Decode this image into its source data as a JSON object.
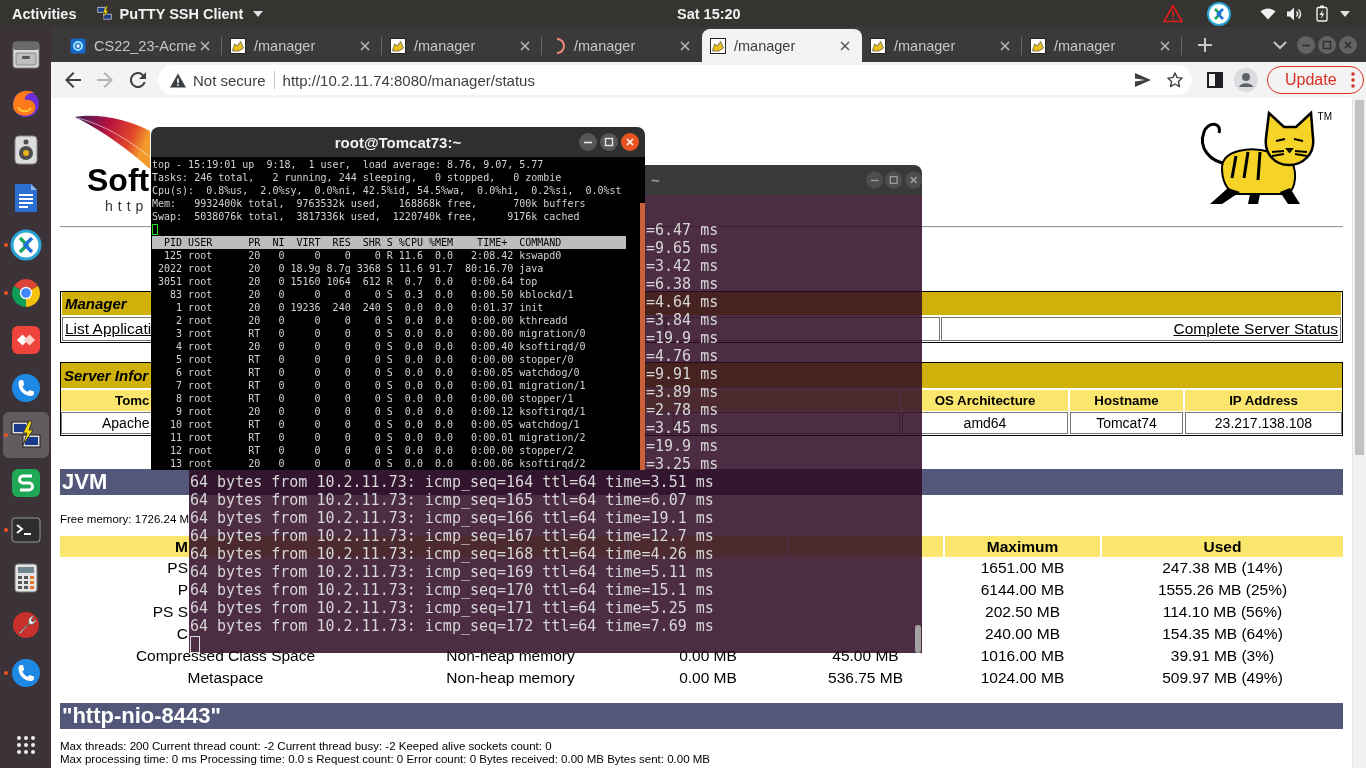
{
  "top_bar": {
    "activities": "Activities",
    "app_menu": "PuTTY SSH Client",
    "clock": "Sat 15:20"
  },
  "dock": {
    "items": [
      {
        "kind": "drawer",
        "running": false,
        "selected": false
      },
      {
        "kind": "globe",
        "running": false,
        "selected": false
      },
      {
        "kind": "speaker",
        "running": false,
        "selected": false
      },
      {
        "kind": "document",
        "running": false,
        "selected": false
      },
      {
        "kind": "sync",
        "running": true,
        "selected": false
      },
      {
        "kind": "wheel",
        "running": true,
        "selected": false
      },
      {
        "kind": "diamond",
        "running": false,
        "selected": false
      },
      {
        "kind": "phone",
        "running": false,
        "selected": false
      },
      {
        "kind": "computers",
        "running": true,
        "selected": true
      },
      {
        "kind": "sheet",
        "running": false,
        "selected": false
      },
      {
        "kind": "terminal",
        "running": true,
        "selected": false
      },
      {
        "kind": "calculator",
        "running": false,
        "selected": false
      },
      {
        "kind": "tools",
        "running": false,
        "selected": false
      },
      {
        "kind": "phone",
        "running": true,
        "selected": false
      }
    ]
  },
  "browser": {
    "tabs": [
      {
        "title": "CS22_23-Acme",
        "selected": false,
        "loading": false
      },
      {
        "title": "/manager",
        "selected": false,
        "loading": false
      },
      {
        "title": "/manager",
        "selected": false,
        "loading": false
      },
      {
        "title": "/manager",
        "selected": false,
        "loading": true
      },
      {
        "title": "/manager",
        "selected": true,
        "loading": false
      },
      {
        "title": "/manager",
        "selected": false,
        "loading": false
      },
      {
        "title": "/manager",
        "selected": false,
        "loading": false
      }
    ],
    "address_bar": {
      "security": "Not secure",
      "url": "http://10.2.11.74:8080/manager/status"
    },
    "update_button": "Update"
  },
  "page": {
    "logo_text": "Soft",
    "logo_url": "http",
    "trademark": "TM",
    "manager": {
      "title": "Manager",
      "links": [
        "List Applicati",
        "Complete Server Status"
      ]
    },
    "server_info": {
      "title": "Server Infor",
      "columns": [
        "Tomc",
        "OS Architecture",
        "Hostname",
        "IP Address"
      ],
      "row": [
        "Apache",
        "amd64",
        "Tomcat74",
        "23.217.138.108"
      ]
    },
    "jvm": {
      "title": "JVM",
      "free_memory": "Free memory: 1726.24 M",
      "table": {
        "header": {
          "kind": "covered",
          "memory_pool": "M",
          "maximum": "Maximum",
          "used": "Used"
        },
        "rows": [
          {
            "kind": "covered",
            "memory_pool": "PS",
            "maximum": "1651.00 MB",
            "used": "247.38 MB (14%)"
          },
          {
            "kind": "covered",
            "memory_pool": "P",
            "maximum": "6144.00 MB",
            "used": "1555.26 MB (25%)"
          },
          {
            "kind": "covered",
            "memory_pool": "PS S",
            "maximum": "202.50 MB",
            "used": "114.10 MB (56%)"
          },
          {
            "kind": "covered",
            "memory_pool": "C",
            "maximum": "240.00 MB",
            "used": "154.35 MB (64%)"
          },
          {
            "kind": "full",
            "memory_pool": "Compressed Class Space",
            "type": "Non-heap memory",
            "initial": "0.00 MB",
            "total": "45.00 MB",
            "maximum": "1016.00 MB",
            "used": "39.91 MB (3%)"
          },
          {
            "kind": "full",
            "memory_pool": "Metaspace",
            "type": "Non-heap memory",
            "initial": "0.00 MB",
            "total": "536.75 MB",
            "maximum": "1024.00 MB",
            "used": "509.97 MB (49%)"
          }
        ]
      }
    },
    "connector": {
      "title": "\"http-nio-8443\"",
      "lines": [
        "Max threads: 200 Current thread count: -2 Current thread busy: -2 Keeped alive sockets count: 0",
        "Max processing time: 0 ms Processing time: 0.0 s Request count: 0 Error count: 0 Bytes received: 0.00 MB Bytes sent: 0.00 MB"
      ]
    }
  },
  "ping_terminal": {
    "title": "~",
    "lines": [
      {
        "kind": "tail",
        "text": "=6.47 ms"
      },
      {
        "kind": "tail",
        "text": "=9.65 ms"
      },
      {
        "kind": "tail",
        "text": "=3.42 ms"
      },
      {
        "kind": "tail",
        "text": "=6.38 ms"
      },
      {
        "kind": "tail",
        "text": "=4.64 ms"
      },
      {
        "kind": "tail",
        "text": "=3.84 ms"
      },
      {
        "kind": "tail",
        "text": "=19.9 ms"
      },
      {
        "kind": "tail",
        "text": "=4.76 ms"
      },
      {
        "kind": "tail",
        "text": "=9.91 ms"
      },
      {
        "kind": "tail",
        "text": "=3.89 ms"
      },
      {
        "kind": "tail",
        "text": "=2.78 ms"
      },
      {
        "kind": "tail",
        "text": "=3.45 ms"
      },
      {
        "kind": "tail",
        "text": "=19.9 ms"
      },
      {
        "kind": "tail",
        "text": "=3.25 ms"
      },
      {
        "kind": "full",
        "text": "64 bytes from 10.2.11.73: icmp_seq=164 ttl=64 time=3.51 ms"
      },
      {
        "kind": "full",
        "text": "64 bytes from 10.2.11.73: icmp_seq=165 ttl=64 time=6.07 ms"
      },
      {
        "kind": "full",
        "text": "64 bytes from 10.2.11.73: icmp_seq=166 ttl=64 time=19.1 ms"
      },
      {
        "kind": "full",
        "text": "64 bytes from 10.2.11.73: icmp_seq=167 ttl=64 time=12.7 ms"
      },
      {
        "kind": "full",
        "text": "64 bytes from 10.2.11.73: icmp_seq=168 ttl=64 time=4.26 ms"
      },
      {
        "kind": "full",
        "text": "64 bytes from 10.2.11.73: icmp_seq=169 ttl=64 time=5.11 ms"
      },
      {
        "kind": "full",
        "text": "64 bytes from 10.2.11.73: icmp_seq=170 ttl=64 time=15.1 ms"
      },
      {
        "kind": "full",
        "text": "64 bytes from 10.2.11.73: icmp_seq=171 ttl=64 time=5.25 ms"
      },
      {
        "kind": "full",
        "text": "64 bytes from 10.2.11.73: icmp_seq=172 ttl=64 time=7.69 ms"
      }
    ]
  },
  "top_terminal": {
    "title": "root@Tomcat73:~",
    "summary": [
      "top - 15:19:01 up  9:18,  1 user,  load average: 8.76, 9.07, 5.77",
      "Tasks: 246 total,   2 running, 244 sleeping,   0 stopped,   0 zombie",
      "Cpu(s):  0.8%us,  2.0%sy,  0.0%ni, 42.5%id, 54.5%wa,  0.0%hi,  0.2%si,  0.0%st",
      "Mem:   9932400k total,  9763532k used,   168868k free,      700k buffers",
      "Swap:  5038076k total,  3817336k used,  1220740k free,     9176k cached"
    ],
    "header": "  PID USER      PR  NI  VIRT  RES  SHR S %CPU %MEM    TIME+  COMMAND",
    "processes": [
      "  125 root      20   0     0    0    0 R 11.6  0.0   2:08.42 kswapd0",
      " 2022 root      20   0 18.9g 8.7g 3368 S 11.6 91.7  80:16.70 java",
      " 3051 root      20   0 15160 1064  612 R  0.7  0.0   0:00.64 top",
      "   83 root      20   0     0    0    0 S  0.3  0.0   0:00.50 kblockd/1",
      "    1 root      20   0 19236  240  240 S  0.0  0.0   0:01.37 init",
      "    2 root      20   0     0    0    0 S  0.0  0.0   0:00.00 kthreadd",
      "    3 root      RT   0     0    0    0 S  0.0  0.0   0:00.00 migration/0",
      "    4 root      20   0     0    0    0 S  0.0  0.0   0:00.40 ksoftirqd/0",
      "    5 root      RT   0     0    0    0 S  0.0  0.0   0:00.00 stopper/0",
      "    6 root      RT   0     0    0    0 S  0.0  0.0   0:00.05 watchdog/0",
      "    7 root      RT   0     0    0    0 S  0.0  0.0   0:00.01 migration/1",
      "    8 root      RT   0     0    0    0 S  0.0  0.0   0:00.00 stopper/1",
      "    9 root      20   0     0    0    0 S  0.0  0.0   0:00.12 ksoftirqd/1",
      "   10 root      RT   0     0    0    0 S  0.0  0.0   0:00.05 watchdog/1",
      "   11 root      RT   0     0    0    0 S  0.0  0.0   0:00.01 migration/2",
      "   12 root      RT   0     0    0    0 S  0.0  0.0   0:00.00 stopper/2",
      "   13 root      20   0     0    0    0 S  0.0  0.0   0:00.06 ksoftirqd/2"
    ]
  }
}
